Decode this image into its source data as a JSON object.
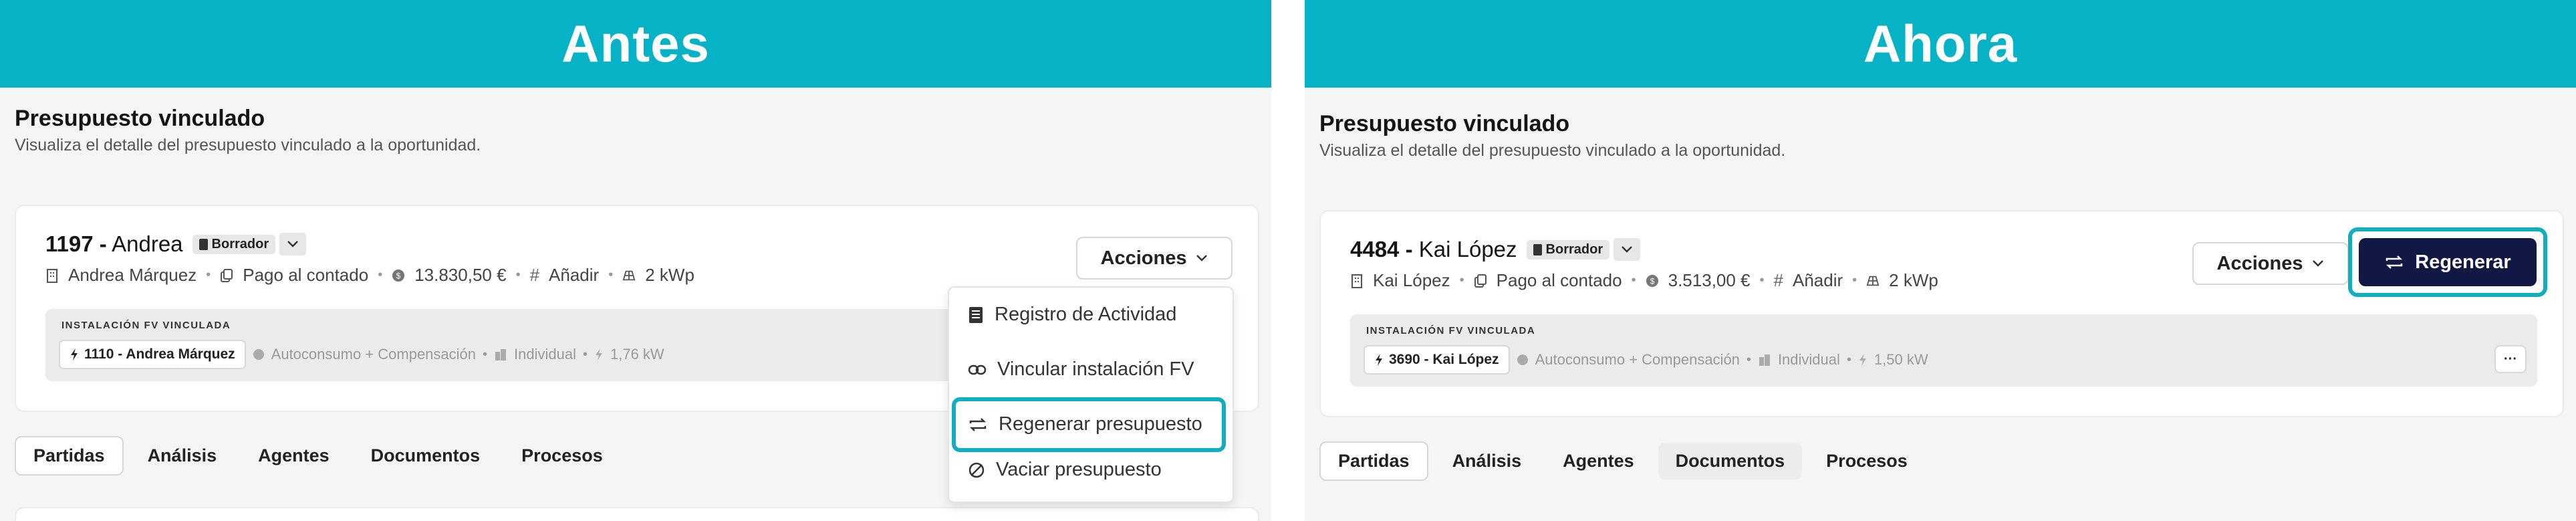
{
  "before": {
    "banner": "Antes",
    "section_title": "Presupuesto vinculado",
    "section_subtitle": "Visualiza el detalle del presupuesto vinculado a la oportunidad.",
    "budget_number": "1197 -",
    "budget_client": "Andrea",
    "status_badge": "Borrador",
    "meta": {
      "client": "Andrea Márquez",
      "payment": "Pago al contado",
      "amount": "13.830,50 €",
      "tag": "Añadir",
      "power": "2 kWp"
    },
    "linked": {
      "label": "INSTALACIÓN FV VINCULADA",
      "chip": "1110 - Andrea Márquez",
      "type": "Autoconsumo + Compensación",
      "mode": "Individual",
      "power": "1,76 kW"
    },
    "actions_label": "Acciones",
    "dropdown": [
      "Registro de Actividad",
      "Vincular instalación FV",
      "Regenerar presupuesto",
      "Vaciar presupuesto"
    ],
    "tabs": [
      "Partidas",
      "Análisis",
      "Agentes",
      "Documentos",
      "Procesos"
    ]
  },
  "after": {
    "banner": "Ahora",
    "section_title": "Presupuesto vinculado",
    "section_subtitle": "Visualiza el detalle del presupuesto vinculado a la oportunidad.",
    "budget_number": "4484 -",
    "budget_client": "Kai López",
    "status_badge": "Borrador",
    "meta": {
      "client": "Kai López",
      "payment": "Pago al contado",
      "amount": "3.513,00 €",
      "tag": "Añadir",
      "power": "2 kWp"
    },
    "linked": {
      "label": "INSTALACIÓN FV VINCULADA",
      "chip": "3690 - Kai López",
      "type": "Autoconsumo + Compensación",
      "mode": "Individual",
      "power": "1,50 kW"
    },
    "actions_label": "Acciones",
    "regenerate_label": "Regenerar",
    "more_label": "···",
    "tabs": [
      "Partidas",
      "Análisis",
      "Agentes",
      "Documentos",
      "Procesos"
    ]
  },
  "colors": {
    "banner": "#06b2c6",
    "highlight": "#12aebf",
    "primary_button": "#121844"
  }
}
